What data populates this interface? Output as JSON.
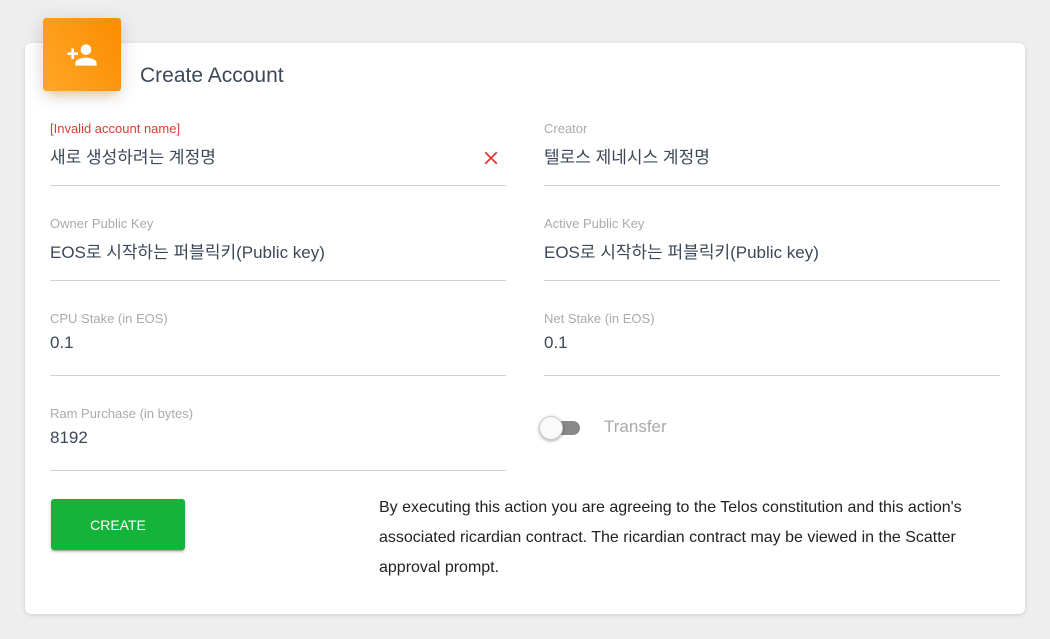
{
  "header": {
    "icon": "person-add-icon",
    "title": "Create Account"
  },
  "fields": {
    "account_name": {
      "label": "[Invalid account name]",
      "value": "새로 생성하려는 계정명",
      "error": true
    },
    "creator": {
      "label": "Creator",
      "value": "텔로스 제네시스 계정명"
    },
    "owner_key": {
      "label": "Owner Public Key",
      "value": "EOS로 시작하는 퍼블릭키(Public key)"
    },
    "active_key": {
      "label": "Active Public Key",
      "value": "EOS로 시작하는 퍼블릭키(Public key)"
    },
    "cpu_stake": {
      "label": "CPU Stake (in EOS)",
      "value": "0.1"
    },
    "net_stake": {
      "label": "Net Stake (in EOS)",
      "value": "0.1"
    },
    "ram_purchase": {
      "label": "Ram Purchase (in bytes)",
      "value": "8192"
    }
  },
  "transfer": {
    "label": "Transfer",
    "enabled": false
  },
  "actions": {
    "create_label": "Create"
  },
  "disclaimer": "By executing this action you are agreeing to the Telos constitution and this action's associated ricardian contract. The ricardian contract may be viewed in the Scatter approval prompt.",
  "colors": {
    "accent": "#fb8c00",
    "error": "#e53935",
    "create_button": "#14b339"
  }
}
